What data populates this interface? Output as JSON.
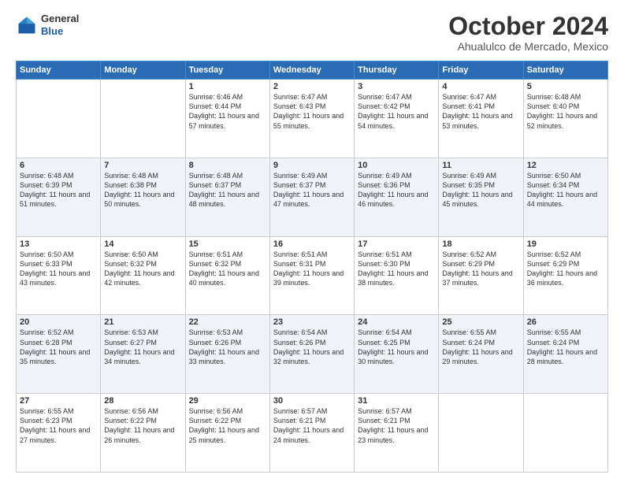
{
  "header": {
    "logo": {
      "general": "General",
      "blue": "Blue"
    },
    "title": "October 2024",
    "location": "Ahualulco de Mercado, Mexico"
  },
  "days_of_week": [
    "Sunday",
    "Monday",
    "Tuesday",
    "Wednesday",
    "Thursday",
    "Friday",
    "Saturday"
  ],
  "weeks": [
    [
      {
        "day": "",
        "empty": true
      },
      {
        "day": "",
        "empty": true
      },
      {
        "day": "1",
        "sunrise": "6:46 AM",
        "sunset": "6:44 PM",
        "daylight": "11 hours and 57 minutes."
      },
      {
        "day": "2",
        "sunrise": "6:47 AM",
        "sunset": "6:43 PM",
        "daylight": "11 hours and 55 minutes."
      },
      {
        "day": "3",
        "sunrise": "6:47 AM",
        "sunset": "6:42 PM",
        "daylight": "11 hours and 54 minutes."
      },
      {
        "day": "4",
        "sunrise": "6:47 AM",
        "sunset": "6:41 PM",
        "daylight": "11 hours and 53 minutes."
      },
      {
        "day": "5",
        "sunrise": "6:48 AM",
        "sunset": "6:40 PM",
        "daylight": "11 hours and 52 minutes."
      }
    ],
    [
      {
        "day": "6",
        "sunrise": "6:48 AM",
        "sunset": "6:39 PM",
        "daylight": "11 hours and 51 minutes."
      },
      {
        "day": "7",
        "sunrise": "6:48 AM",
        "sunset": "6:38 PM",
        "daylight": "11 hours and 50 minutes."
      },
      {
        "day": "8",
        "sunrise": "6:48 AM",
        "sunset": "6:37 PM",
        "daylight": "11 hours and 48 minutes."
      },
      {
        "day": "9",
        "sunrise": "6:49 AM",
        "sunset": "6:37 PM",
        "daylight": "11 hours and 47 minutes."
      },
      {
        "day": "10",
        "sunrise": "6:49 AM",
        "sunset": "6:36 PM",
        "daylight": "11 hours and 46 minutes."
      },
      {
        "day": "11",
        "sunrise": "6:49 AM",
        "sunset": "6:35 PM",
        "daylight": "11 hours and 45 minutes."
      },
      {
        "day": "12",
        "sunrise": "6:50 AM",
        "sunset": "6:34 PM",
        "daylight": "11 hours and 44 minutes."
      }
    ],
    [
      {
        "day": "13",
        "sunrise": "6:50 AM",
        "sunset": "6:33 PM",
        "daylight": "11 hours and 43 minutes."
      },
      {
        "day": "14",
        "sunrise": "6:50 AM",
        "sunset": "6:32 PM",
        "daylight": "11 hours and 42 minutes."
      },
      {
        "day": "15",
        "sunrise": "6:51 AM",
        "sunset": "6:32 PM",
        "daylight": "11 hours and 40 minutes."
      },
      {
        "day": "16",
        "sunrise": "6:51 AM",
        "sunset": "6:31 PM",
        "daylight": "11 hours and 39 minutes."
      },
      {
        "day": "17",
        "sunrise": "6:51 AM",
        "sunset": "6:30 PM",
        "daylight": "11 hours and 38 minutes."
      },
      {
        "day": "18",
        "sunrise": "6:52 AM",
        "sunset": "6:29 PM",
        "daylight": "11 hours and 37 minutes."
      },
      {
        "day": "19",
        "sunrise": "6:52 AM",
        "sunset": "6:29 PM",
        "daylight": "11 hours and 36 minutes."
      }
    ],
    [
      {
        "day": "20",
        "sunrise": "6:52 AM",
        "sunset": "6:28 PM",
        "daylight": "11 hours and 35 minutes."
      },
      {
        "day": "21",
        "sunrise": "6:53 AM",
        "sunset": "6:27 PM",
        "daylight": "11 hours and 34 minutes."
      },
      {
        "day": "22",
        "sunrise": "6:53 AM",
        "sunset": "6:26 PM",
        "daylight": "11 hours and 33 minutes."
      },
      {
        "day": "23",
        "sunrise": "6:54 AM",
        "sunset": "6:26 PM",
        "daylight": "11 hours and 32 minutes."
      },
      {
        "day": "24",
        "sunrise": "6:54 AM",
        "sunset": "6:25 PM",
        "daylight": "11 hours and 30 minutes."
      },
      {
        "day": "25",
        "sunrise": "6:55 AM",
        "sunset": "6:24 PM",
        "daylight": "11 hours and 29 minutes."
      },
      {
        "day": "26",
        "sunrise": "6:55 AM",
        "sunset": "6:24 PM",
        "daylight": "11 hours and 28 minutes."
      }
    ],
    [
      {
        "day": "27",
        "sunrise": "6:55 AM",
        "sunset": "6:23 PM",
        "daylight": "11 hours and 27 minutes."
      },
      {
        "day": "28",
        "sunrise": "6:56 AM",
        "sunset": "6:22 PM",
        "daylight": "11 hours and 26 minutes."
      },
      {
        "day": "29",
        "sunrise": "6:56 AM",
        "sunset": "6:22 PM",
        "daylight": "11 hours and 25 minutes."
      },
      {
        "day": "30",
        "sunrise": "6:57 AM",
        "sunset": "6:21 PM",
        "daylight": "11 hours and 24 minutes."
      },
      {
        "day": "31",
        "sunrise": "6:57 AM",
        "sunset": "6:21 PM",
        "daylight": "11 hours and 23 minutes."
      },
      {
        "day": "",
        "empty": true
      },
      {
        "day": "",
        "empty": true
      }
    ]
  ],
  "labels": {
    "sunrise": "Sunrise:",
    "sunset": "Sunset:",
    "daylight": "Daylight:"
  }
}
